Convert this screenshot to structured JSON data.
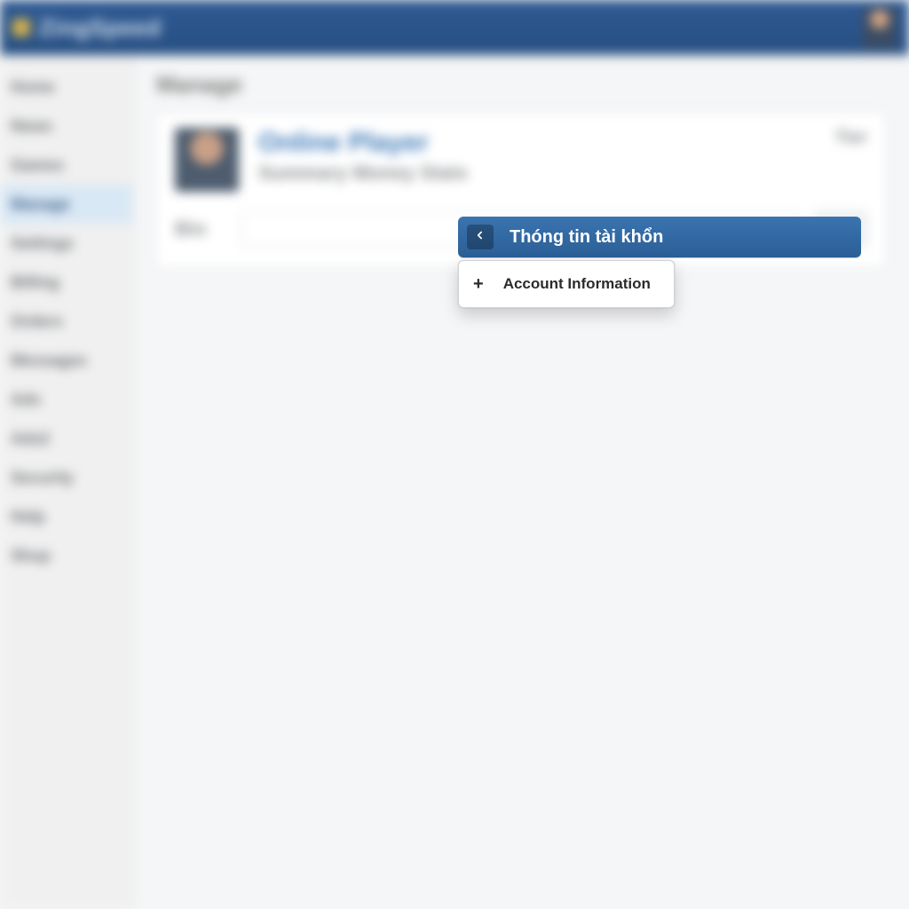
{
  "topbar": {
    "brand": "ZingSpeed"
  },
  "sidebar": {
    "items": [
      {
        "label": "Home",
        "active": false
      },
      {
        "label": "News",
        "active": false
      },
      {
        "label": "Games",
        "active": false
      },
      {
        "label": "Manage",
        "active": true
      },
      {
        "label": "Settings",
        "active": false
      },
      {
        "label": "Billing",
        "active": false
      },
      {
        "label": "Orders",
        "active": false
      },
      {
        "label": "Messages",
        "active": false
      },
      {
        "label": "Ads",
        "active": false
      },
      {
        "label": "Ads2",
        "active": false
      },
      {
        "label": "Security",
        "active": false
      },
      {
        "label": "Help",
        "active": false
      },
      {
        "label": "Shop",
        "active": false
      }
    ]
  },
  "main": {
    "page_title": "Manage",
    "profile": {
      "name": "Online Player",
      "subtitle": "Summary Money Stats",
      "right_label": "Tier"
    },
    "field": {
      "label": "Bio"
    }
  },
  "overlay": {
    "title": "Thóng tin tài khổn",
    "menu": {
      "item1": "Account Information"
    }
  }
}
